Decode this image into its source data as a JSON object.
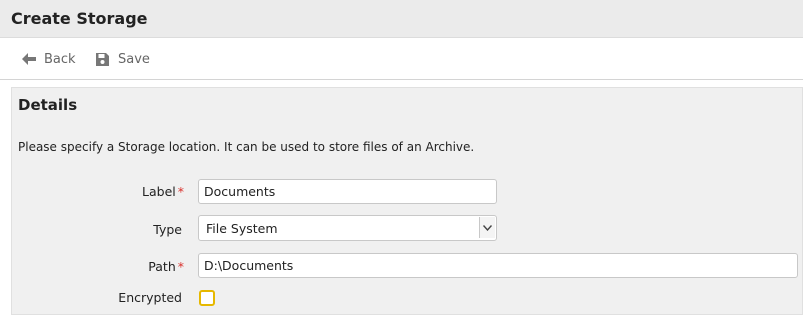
{
  "header": {
    "title": "Create Storage"
  },
  "toolbar": {
    "back_label": "Back",
    "save_label": "Save",
    "back_icon": "arrow-left-icon",
    "save_icon": "floppy-disk-icon"
  },
  "details": {
    "title": "Details",
    "description": "Please specify a Storage location. It can be used to store files of an Archive.",
    "required_marker": "*",
    "fields": {
      "label": {
        "label": "Label",
        "value": "Documents",
        "required": true
      },
      "type": {
        "label": "Type",
        "value": "File System",
        "required": false
      },
      "path": {
        "label": "Path",
        "value": "D:\\Documents",
        "required": true
      },
      "encrypted": {
        "label": "Encrypted",
        "checked": false
      }
    }
  },
  "colors": {
    "required": "#d9302c",
    "checkbox_border": "#e6b800",
    "panel_bg": "#f0f0f0",
    "title_bar_bg": "#ebebeb"
  }
}
